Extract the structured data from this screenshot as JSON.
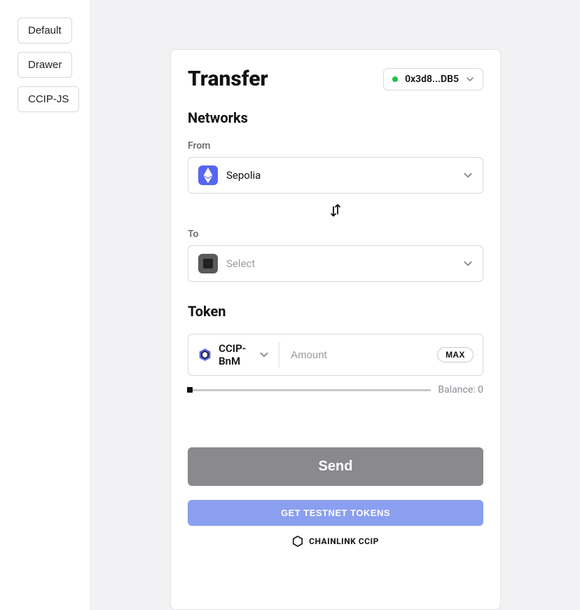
{
  "sidebar": {
    "items": [
      {
        "label": "Default"
      },
      {
        "label": "Drawer"
      },
      {
        "label": "CCIP-JS"
      }
    ]
  },
  "header": {
    "title": "Transfer",
    "wallet_address": "0x3d8...DB5"
  },
  "networks": {
    "section_label": "Networks",
    "from_label": "From",
    "from_value": "Sepolia",
    "to_label": "To",
    "to_placeholder": "Select"
  },
  "token": {
    "section_label": "Token",
    "selected": "CCIP-BnM",
    "amount_placeholder": "Amount",
    "max_label": "MAX",
    "balance_label": "Balance: 0"
  },
  "actions": {
    "send_label": "Send",
    "faucet_label": "GET TESTNET TOKENS",
    "brand_label": "CHAINLINK CCIP"
  }
}
